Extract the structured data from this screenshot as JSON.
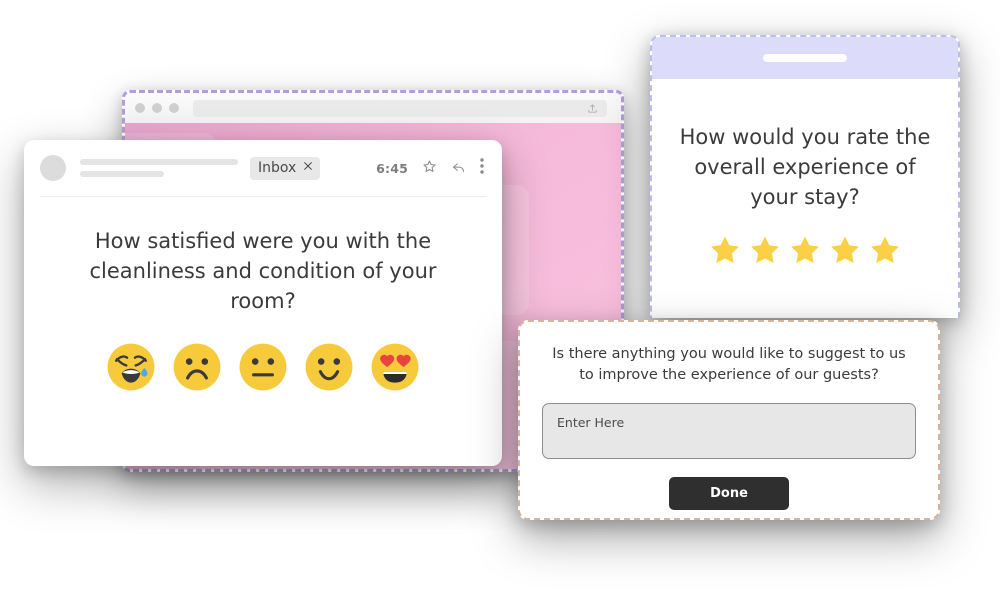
{
  "browser_window": {
    "name": "browser-window",
    "traffic_lights": [
      "dot-red",
      "dot-yellow",
      "dot-green"
    ],
    "address_bar_value": "",
    "address_bar_placeholder": "",
    "share_icon": "upload-share-icon",
    "background_color": "#f2b4d8",
    "border_color": "#b39ddb"
  },
  "email_card": {
    "avatar": "avatar-placeholder",
    "chip_label": "Inbox",
    "chip_close_icon": "close-icon",
    "time": "6:45",
    "star_icon": "star-outline-icon",
    "reply_icon": "reply-arrow-icon",
    "more_icon": "more-vertical-icon",
    "question": "How satisfied were you with the cleanliness and condition of your room?",
    "emojis": [
      {
        "name": "crying-face-emoji",
        "label": "Crying face"
      },
      {
        "name": "frowning-face-emoji",
        "label": "Frowning face"
      },
      {
        "name": "neutral-face-emoji",
        "label": "Neutral face"
      },
      {
        "name": "slightly-smiling-face-emoji",
        "label": "Slightly smiling face"
      },
      {
        "name": "heart-eyes-face-emoji",
        "label": "Smiling face with heart eyes"
      }
    ],
    "emoji_color": "#f7ca3c",
    "emoji_shade_color": "#efb92e"
  },
  "phone_card": {
    "statusbar_color": "#dcdcfa",
    "speaker": "phone-speaker",
    "question": "How would you rate the overall experience of your stay?",
    "rating": {
      "max": 5,
      "filled": 5,
      "star_color": "#fbd044"
    }
  },
  "suggestion_dialog": {
    "question": "Is there anything you would like to suggest to us to improve the experience of our guests?",
    "input_value": "",
    "input_placeholder": "Enter Here",
    "submit_label": "Done",
    "submit_color": "#2f2f2f",
    "border_color": "#d6b49a"
  }
}
